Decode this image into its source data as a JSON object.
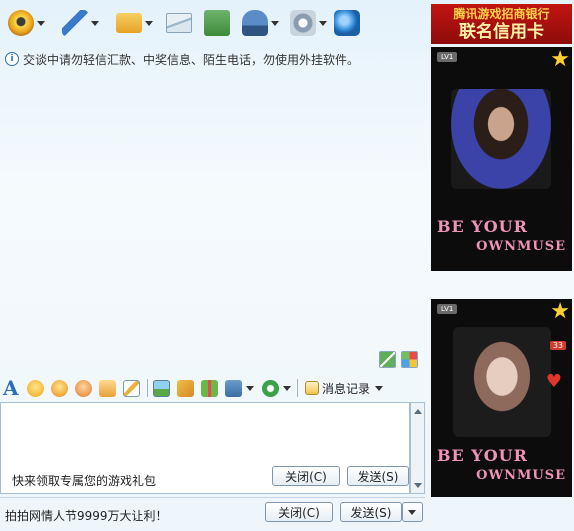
{
  "toolbar": {
    "items": [
      {
        "icon": "webcam-icon",
        "color": "#e8a21c",
        "has_menu": true
      },
      {
        "icon": "microphone-icon",
        "color": "#3b79c9",
        "has_menu": true
      },
      {
        "icon": "folder-transfer-icon",
        "color": "#e6a324",
        "has_menu": true
      },
      {
        "icon": "envelope-icon",
        "color": "#9bb7cc",
        "has_menu": false
      },
      {
        "icon": "add-note-icon",
        "color": "#3d8a3a",
        "has_menu": false
      },
      {
        "icon": "police-hat-icon",
        "color": "#3f6fa8",
        "has_menu": true
      },
      {
        "icon": "settings-gear-icon",
        "color": "#8a9cb0",
        "has_menu": true
      },
      {
        "icon": "refresh-globe-icon",
        "color": "#2f88d6",
        "has_menu": false
      }
    ]
  },
  "notice": {
    "text": "交谈中请勿轻信汇款、中奖信息、陌生电话，勿使用外挂软件。"
  },
  "format_bar": {
    "font_glyph": "A",
    "icons": [
      "emoticon-icon",
      "magic-face-icon",
      "winking-face-icon",
      "hand-icon",
      "pencil-icon",
      "image-icon",
      "music-note-icon",
      "gift-icon",
      "screenshot-icon",
      "payment-icon"
    ],
    "message_record_label": "消息记录"
  },
  "input": {
    "value": "",
    "promo_text": "快来领取专属您的游戏礼包",
    "close_label": "关闭(C)",
    "send_label": "发送(S)"
  },
  "status_bar": {
    "text": "拍拍网情人节9999万大让利！",
    "close_label": "关闭(C)",
    "send_label": "发送(S)"
  },
  "ad": {
    "banner_line1": "腾讯游戏招商银行",
    "banner_line2": "联名信用卡"
  },
  "show_top": {
    "level": "LV1",
    "muse_line1": "BE YOUR",
    "muse_line2": "OWNMUSE"
  },
  "show_bottom": {
    "level": "LV1",
    "badge": "33",
    "muse_line1": "BE YOUR",
    "muse_line2": "OWNMUSE"
  }
}
